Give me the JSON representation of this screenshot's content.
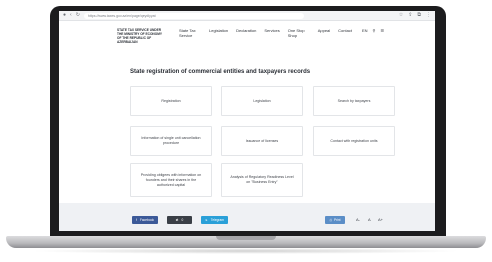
{
  "browser": {
    "url": "https://www.taxes.gov.az/en/page/qeydiyyat",
    "icons": [
      "window-controls-icon",
      "back-icon",
      "reload-icon"
    ],
    "right_icons": [
      "star-icon",
      "share-icon",
      "extensions-icon",
      "menu-icon"
    ]
  },
  "header": {
    "org_name_lines": [
      "STATE TAX SERVICE UNDER",
      "THE MINISTRY OF ECONOMY",
      "OF THE REPUBLIC OF AZERBAIJAN"
    ],
    "nav": [
      {
        "label": "State Tax\nService"
      },
      {
        "label": "Legislation"
      },
      {
        "label": "Declaration"
      },
      {
        "label": "Services"
      },
      {
        "label": "One Stop\nShop"
      },
      {
        "label": "Appeal"
      },
      {
        "label": "Contact"
      }
    ],
    "lang": "EN",
    "search_icon": "search-icon",
    "menu_icon": "menu-icon"
  },
  "main": {
    "title": "State registration of commercial entities and taxpayers records",
    "tiles": [
      "Registration",
      "Legislation",
      "Search by taxpayers",
      "Information of single unit cancellation procedure",
      "Issuance of licenses",
      "Contact with registration units",
      "Providing obligees with information on founders and their shares in the authorized capital",
      "Analysis of Regulatory Readiness Level on \"Business Entry\""
    ]
  },
  "footer": {
    "facebook": "Facebook",
    "share_count": "0",
    "share_icon": "share-icon",
    "telegram": "Telegram",
    "print": "Print",
    "font_sizes": [
      "A-",
      "A",
      "A+"
    ]
  },
  "colors": {
    "facebook": "#3b5998",
    "telegram": "#2aa0d8",
    "print": "#5b8ec7",
    "footer_bg": "#eff1f4"
  }
}
